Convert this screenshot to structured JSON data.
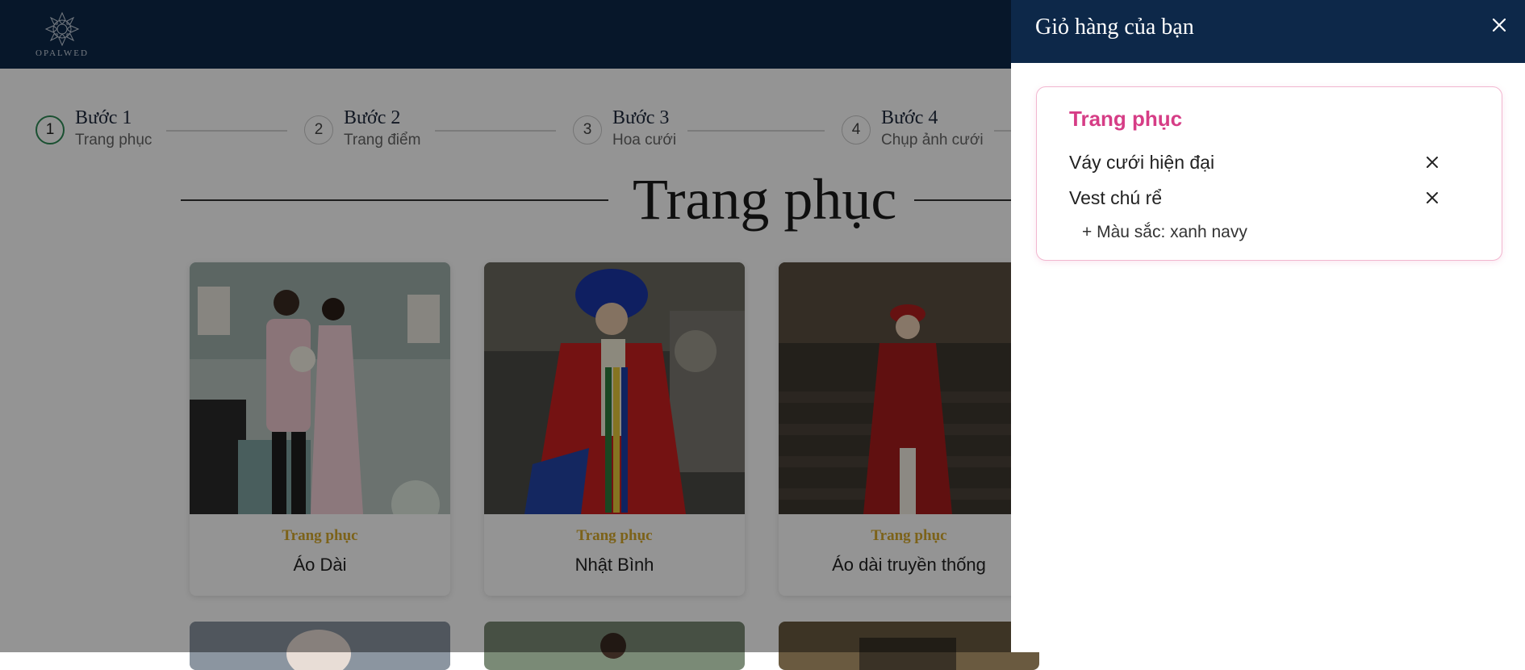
{
  "header": {
    "logo_text": "OPALWED"
  },
  "steps": [
    {
      "number": "1",
      "title": "Bước 1",
      "subtitle": "Trang phục",
      "active": true
    },
    {
      "number": "2",
      "title": "Bước 2",
      "subtitle": "Trang điểm",
      "active": false
    },
    {
      "number": "3",
      "title": "Bước 3",
      "subtitle": "Hoa cưới",
      "active": false
    },
    {
      "number": "4",
      "title": "Bước 4",
      "subtitle": "Chụp ảnh cưới",
      "active": false
    }
  ],
  "section": {
    "title": "Trang phục"
  },
  "products": [
    {
      "category": "Trang phục",
      "name": "Áo Dài"
    },
    {
      "category": "Trang phục",
      "name": "Nhật Bình"
    },
    {
      "category": "Trang phục",
      "name": "Áo dài truyền thống"
    }
  ],
  "cart": {
    "title": "Giỏ hàng của bạn",
    "category": "Trang phục",
    "items": [
      {
        "name": "Váy cưới hiện đại"
      },
      {
        "name": "Vest chú rể"
      }
    ],
    "option": "+ Màu sắc: xanh navy"
  },
  "colors": {
    "navy": "#0d2849",
    "gold": "#d6a92b",
    "pink": "#d63d86",
    "green": "#2d8a55"
  },
  "icons": [
    "mandala-logo-icon",
    "close-icon",
    "remove-item-icon"
  ]
}
